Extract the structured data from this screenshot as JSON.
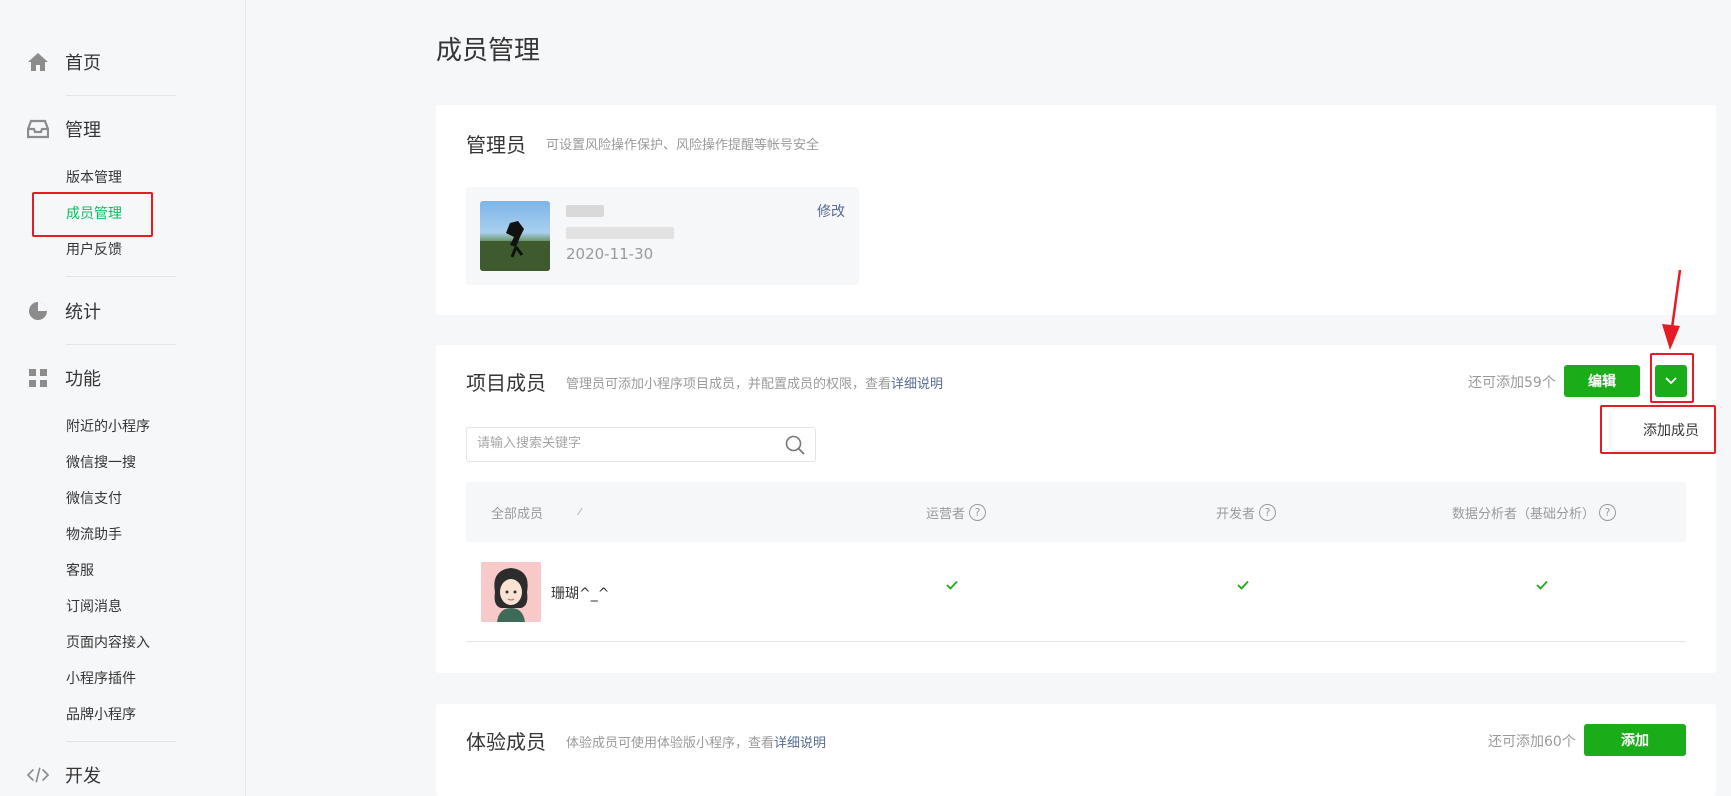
{
  "sidebar": {
    "home": {
      "label": "首页",
      "icon": "home-icon"
    },
    "manage": {
      "label": "管理",
      "icon": "inbox-icon",
      "items": [
        "版本管理",
        "成员管理",
        "用户反馈"
      ]
    },
    "stats": {
      "label": "统计",
      "icon": "pie-chart-icon"
    },
    "features": {
      "label": "功能",
      "icon": "grid-icon",
      "items": [
        "附近的小程序",
        "微信搜一搜",
        "微信支付",
        "物流助手",
        "客服",
        "订阅消息",
        "页面内容接入",
        "小程序插件",
        "品牌小程序"
      ]
    },
    "develop": {
      "label": "开发",
      "icon": "code-icon"
    },
    "active_item": "成员管理"
  },
  "page": {
    "title": "成员管理"
  },
  "admin": {
    "title": "管理员",
    "desc": "可设置风险操作保护、风险操作提醒等帐号安全",
    "date": "2020-11-30",
    "edit_label": "修改"
  },
  "project": {
    "title": "项目成员",
    "desc_prefix": "管理员可添加小程序项目成员，并配置成员的权限，查看",
    "desc_link": "详细说明",
    "remaining": "还可添加59个",
    "edit_button": "编辑",
    "dropdown_item": "添加成员",
    "search_placeholder": "请输入搜索关键字",
    "columns": [
      "全部成员",
      "运营者",
      "开发者",
      "数据分析者（基础分析）"
    ],
    "members": [
      {
        "name": "珊瑚^_^",
        "operator": true,
        "developer": true,
        "analyst": true
      }
    ]
  },
  "experience": {
    "title": "体验成员",
    "desc_prefix": "体验成员可使用体验版小程序，查看",
    "desc_link": "详细说明",
    "remaining": "还可添加60个",
    "add_button": "添加"
  },
  "colors": {
    "accent": "#1aad19",
    "link": "#576b95",
    "annotation": "#e51c23"
  }
}
